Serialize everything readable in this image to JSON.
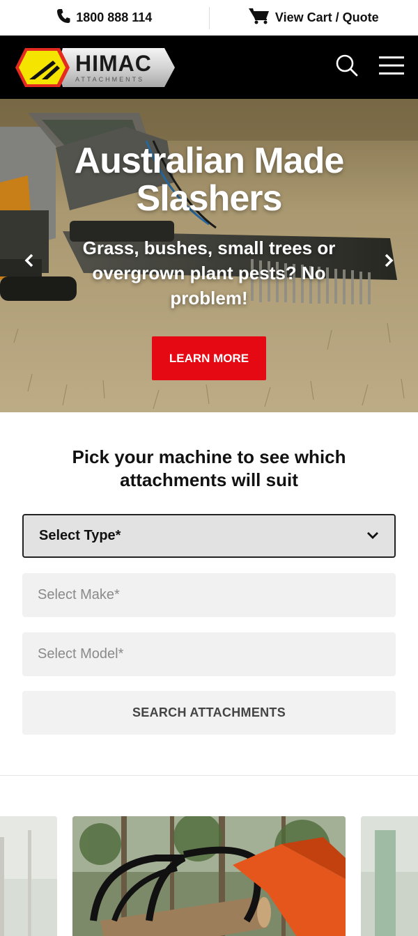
{
  "topbar": {
    "phone": "1800 888 114",
    "cart": "View Cart / Quote"
  },
  "header": {
    "logo_main": "HIMAC",
    "logo_sub": "ATTACHMENTS"
  },
  "hero": {
    "title": "Australian Made Slashers",
    "subtitle": "Grass, bushes, small trees or overgrown plant pests? No problem!",
    "cta": "LEARN MORE"
  },
  "finder": {
    "title": "Pick your machine to see which attachments will suit",
    "type_label": "Select Type*",
    "make_placeholder": "Select Make*",
    "model_placeholder": "Select Model*",
    "search_label": "SEARCH ATTACHMENTS"
  },
  "colors": {
    "brand_yellow": "#f5e400",
    "brand_red": "#e50914",
    "header_bg": "#000000"
  },
  "icons": [
    "phone-icon",
    "cart-icon",
    "search-icon",
    "menu-icon",
    "chevron-left-icon",
    "chevron-right-icon",
    "chevron-down-icon"
  ]
}
